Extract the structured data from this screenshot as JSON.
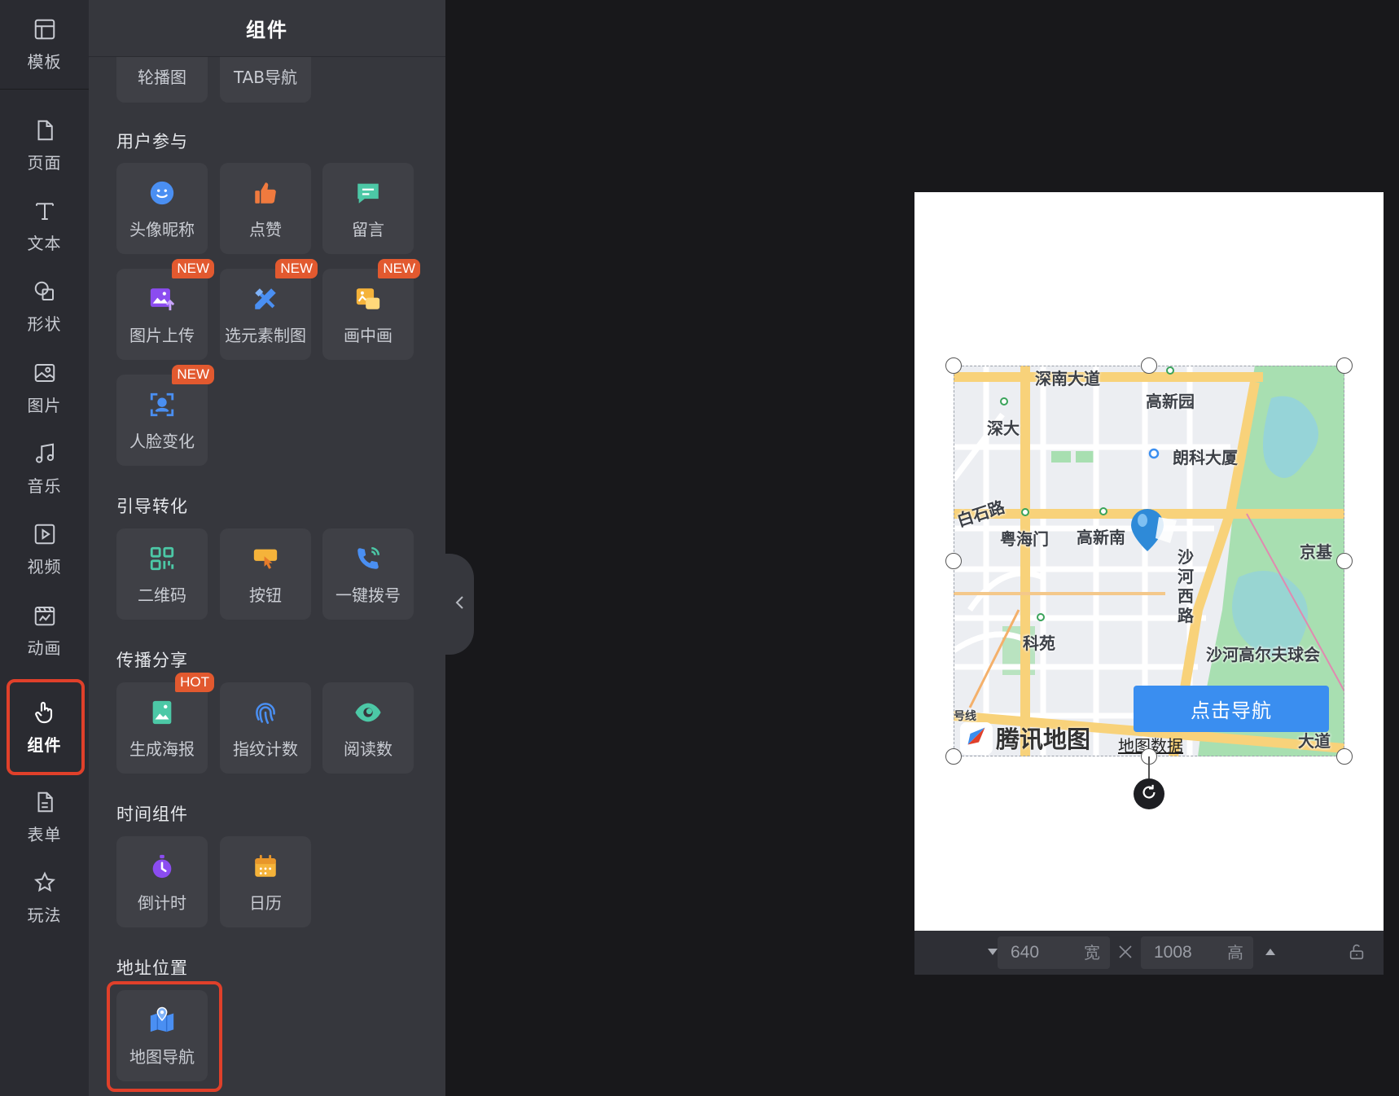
{
  "rail": {
    "items": [
      {
        "label": "模板",
        "icon": "template-icon"
      },
      {
        "label": "页面",
        "icon": "page-icon"
      },
      {
        "label": "文本",
        "icon": "text-icon"
      },
      {
        "label": "形状",
        "icon": "shape-icon"
      },
      {
        "label": "图片",
        "icon": "image-icon"
      },
      {
        "label": "音乐",
        "icon": "music-icon"
      },
      {
        "label": "视频",
        "icon": "video-icon"
      },
      {
        "label": "动画",
        "icon": "animation-icon"
      },
      {
        "label": "组件",
        "icon": "hand-pointer-icon",
        "active": true
      },
      {
        "label": "表单",
        "icon": "form-icon"
      },
      {
        "label": "玩法",
        "icon": "star-icon"
      }
    ]
  },
  "panel": {
    "title": "组件",
    "top_row": [
      "轮播图",
      "TAB导航"
    ],
    "sections": [
      {
        "title": "用户参与",
        "tiles": [
          {
            "label": "头像昵称",
            "icon": "smiley-icon"
          },
          {
            "label": "点赞",
            "icon": "thumbs-up-icon"
          },
          {
            "label": "留言",
            "icon": "comment-icon"
          },
          {
            "label": "图片上传",
            "icon": "image-upload-icon",
            "badge": "NEW"
          },
          {
            "label": "选元素制图",
            "icon": "pencil-ruler-icon",
            "badge": "NEW"
          },
          {
            "label": "画中画",
            "icon": "picture-in-picture-icon",
            "badge": "NEW"
          },
          {
            "label": "人脸变化",
            "icon": "face-scan-icon",
            "badge": "NEW"
          }
        ]
      },
      {
        "title": "引导转化",
        "tiles": [
          {
            "label": "二维码",
            "icon": "qr-code-icon"
          },
          {
            "label": "按钮",
            "icon": "button-tap-icon"
          },
          {
            "label": "一键拨号",
            "icon": "phone-call-icon"
          }
        ]
      },
      {
        "title": "传播分享",
        "tiles": [
          {
            "label": "生成海报",
            "icon": "poster-icon",
            "badge": "HOT"
          },
          {
            "label": "指纹计数",
            "icon": "fingerprint-icon"
          },
          {
            "label": "阅读数",
            "icon": "eye-icon"
          }
        ]
      },
      {
        "title": "时间组件",
        "tiles": [
          {
            "label": "倒计时",
            "icon": "stopwatch-icon"
          },
          {
            "label": "日历",
            "icon": "calendar-icon"
          }
        ]
      },
      {
        "title": "地址位置",
        "tiles": [
          {
            "label": "地图导航",
            "icon": "map-pin-icon"
          }
        ]
      }
    ]
  },
  "canvas": {
    "map": {
      "labels": {
        "shennan": "深南大道",
        "gaoxinyuan": "高新园",
        "shenda": "深大",
        "langke": "朗科大厦",
        "baishi": "白石路",
        "yuehaimen": "粤海门",
        "gaoxinnan": "高新南",
        "shahexilu": "沙河西路",
        "jingji": "京基",
        "kexuan": "科苑",
        "golf": "沙河高尔夫球会",
        "dadao": "大道",
        "line": "号线"
      },
      "logo_text": "腾讯地图",
      "data_link": "地图数据",
      "nav_button": "点击导航"
    },
    "size": {
      "width": "640",
      "width_unit": "宽",
      "height": "1008",
      "height_unit": "高"
    }
  },
  "colors": {
    "accent": "#3a8ef0",
    "highlight": "#e0402a",
    "badge": "#e2592f"
  }
}
